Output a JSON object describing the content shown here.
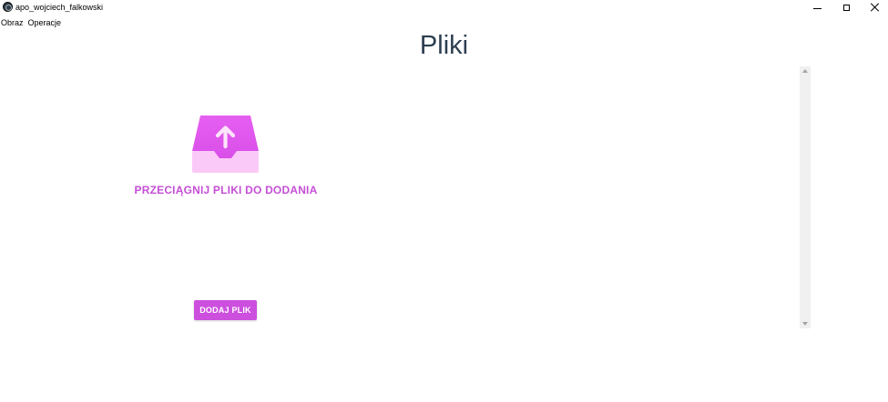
{
  "window": {
    "title": "apo_wojciech_falkowski",
    "icon": "app-logo-icon",
    "controls": [
      "minimize-icon",
      "maximize-icon",
      "close-icon"
    ]
  },
  "menubar": {
    "items": [
      {
        "label": "Obraz"
      },
      {
        "label": "Operacje"
      }
    ]
  },
  "main": {
    "title": "Pliki",
    "dropzone": {
      "icon": "upload-tray-icon",
      "label": "PRZECIĄGNIJ PLIKI DO DODANIA"
    },
    "add_button_label": "DODAJ PLIK"
  },
  "colors": {
    "accent": "#cc4fde",
    "accent_text": "#c54fd6",
    "title_text": "#2c3e50",
    "icon_light": "#f8c4f6",
    "icon_dark": "#e35ef0"
  }
}
